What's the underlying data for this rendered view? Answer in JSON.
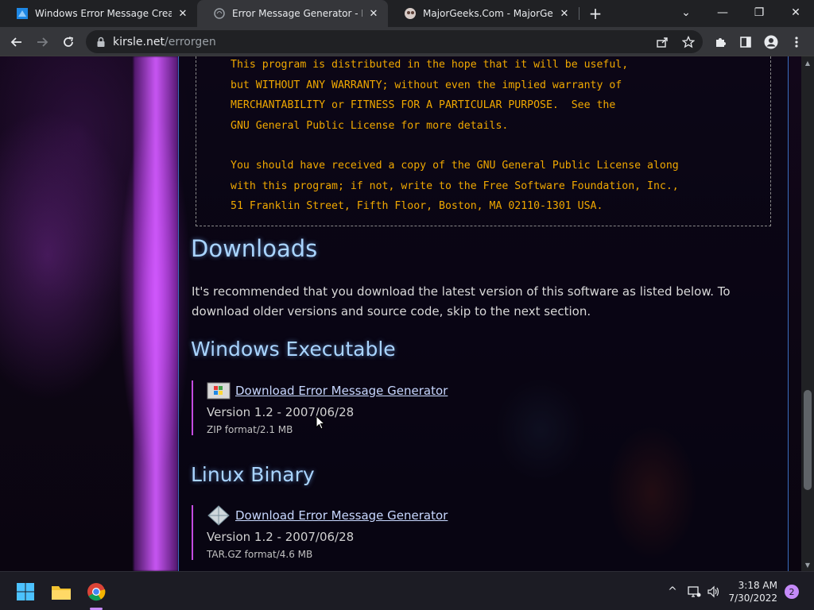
{
  "tabs": [
    {
      "title": "Windows Error Message Creator",
      "icon": "windows-error-favicon",
      "active": false
    },
    {
      "title": "Error Message Generator - Kirsle",
      "icon": "kirsle-favicon",
      "active": true
    },
    {
      "title": "MajorGeeks.Com - MajorGeeks",
      "icon": "majorgeeks-favicon",
      "active": false
    }
  ],
  "tab_close_glyph": "✕",
  "newtab_glyph": "+",
  "window_controls": {
    "chevron": "⌄",
    "minimize": "—",
    "restore": "❐",
    "close": "✕"
  },
  "address": {
    "host": "kirsle.net",
    "path": "/errorgen"
  },
  "license_lines_1": [
    "This program is distributed in the hope that it will be useful,",
    "but WITHOUT ANY WARRANTY; without even the implied warranty of",
    "MERCHANTABILITY or FITNESS FOR A PARTICULAR PURPOSE.  See the",
    "GNU General Public License for more details."
  ],
  "license_lines_2": [
    "You should have received a copy of the GNU General Public License along",
    "with this program; if not, write to the Free Software Foundation, Inc.,",
    "51 Franklin Street, Fifth Floor, Boston, MA 02110-1301 USA."
  ],
  "downloads": {
    "heading": "Downloads",
    "intro": "It's recommended that you download the latest version of this software as listed below. To download older versions and source code, skip to the next section.",
    "windows": {
      "heading": "Windows Executable",
      "link": "Download Error Message Generator",
      "version": "Version 1.2 - 2007/06/28",
      "format": "ZIP format/2.1 MB"
    },
    "linux": {
      "heading": "Linux Binary",
      "link": "Download Error Message Generator",
      "version": "Version 1.2 - 2007/06/28",
      "format": "TAR.GZ format/4.6 MB"
    }
  },
  "taskbar": {
    "time": "3:18 AM",
    "date": "7/30/2022",
    "notification_count": "2",
    "tray_chevron": "^"
  },
  "colors": {
    "license_text": "#f0a800",
    "heading": "#a9d4ff",
    "accent_border": "#c44ce0",
    "panel_border": "#3a6ec0"
  }
}
